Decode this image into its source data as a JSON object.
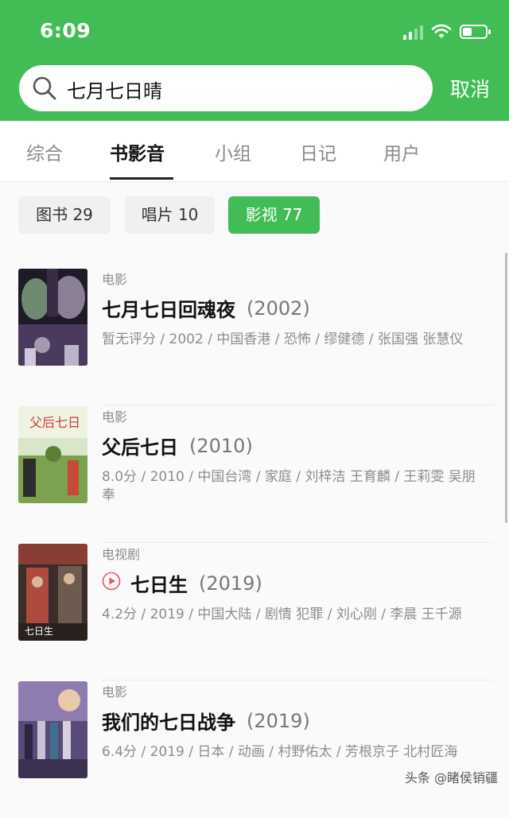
{
  "status_bar": {
    "time": "6:09"
  },
  "search": {
    "value": "七月七日晴",
    "cancel_label": "取消"
  },
  "tabs": [
    {
      "label": "综合"
    },
    {
      "label": "书影音"
    },
    {
      "label": "小组"
    },
    {
      "label": "日记"
    },
    {
      "label": "用户"
    }
  ],
  "filters": [
    {
      "label": "图书 29"
    },
    {
      "label": "唱片 10"
    },
    {
      "label": "影视 77"
    }
  ],
  "results": [
    {
      "type": "电影",
      "title": "七月七日回魂夜",
      "year": "(2002)",
      "meta": "暂无评分 / 2002 / 中国香港 / 恐怖 / 缪健德 / 张国强 张慧仪"
    },
    {
      "type": "电影",
      "title": "父后七日",
      "year": "(2010)",
      "meta": "8.0分 / 2010 / 中国台湾 / 家庭 / 刘梓洁 王育麟 / 王莉雯 吴朋奉"
    },
    {
      "type": "电视剧",
      "title": "七日生",
      "year": "(2019)",
      "meta": "4.2分 / 2019 / 中国大陆 / 剧情 犯罪 / 刘心刚 / 李晨 王千源"
    },
    {
      "type": "电影",
      "title": "我们的七日战争",
      "year": "(2019)",
      "meta": "6.4分 / 2019 / 日本 / 动画 / 村野佑太 / 芳根京子 北村匠海"
    }
  ],
  "watermark": "头条 @睹侯销疆",
  "colors": {
    "accent": "#42bd56",
    "play_icon": "#e05c5c"
  }
}
